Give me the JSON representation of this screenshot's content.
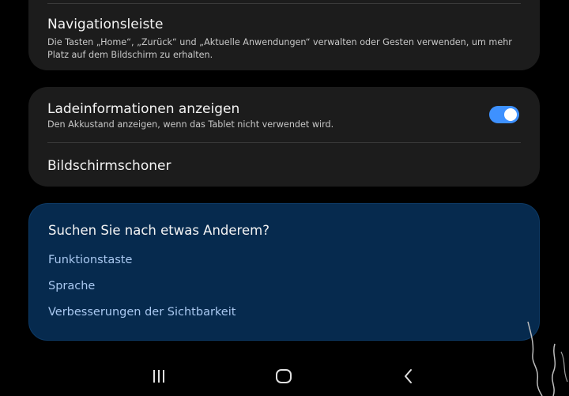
{
  "settings_top": {
    "title": "Navigationsleiste",
    "description": "Die Tasten „Home“, „Zurück“ und „Aktuelle Anwendungen“ verwalten oder Gesten verwenden, um mehr Platz auf dem Bildschirm zu erhalten."
  },
  "settings_mid": {
    "charging_info": {
      "title": "Ladeinformationen anzeigen",
      "description": "Den Akkustand anzeigen, wenn das Tablet nicht verwendet wird.",
      "enabled": true
    },
    "screensaver": {
      "title": "Bildschirmschoner"
    }
  },
  "suggestions": {
    "title": "Suchen Sie nach etwas Anderem?",
    "links": [
      "Funktionstaste",
      "Sprache",
      "Verbesserungen der Sichtbarkeit"
    ]
  },
  "navbar": {
    "icons": [
      "recents-icon",
      "home-icon",
      "back-icon"
    ]
  },
  "colors": {
    "background": "#000000",
    "card": "#1c1c1c",
    "suggest_card": "#062a4e",
    "toggle_on": "#3e91ff",
    "link": "#a9c8f0"
  }
}
